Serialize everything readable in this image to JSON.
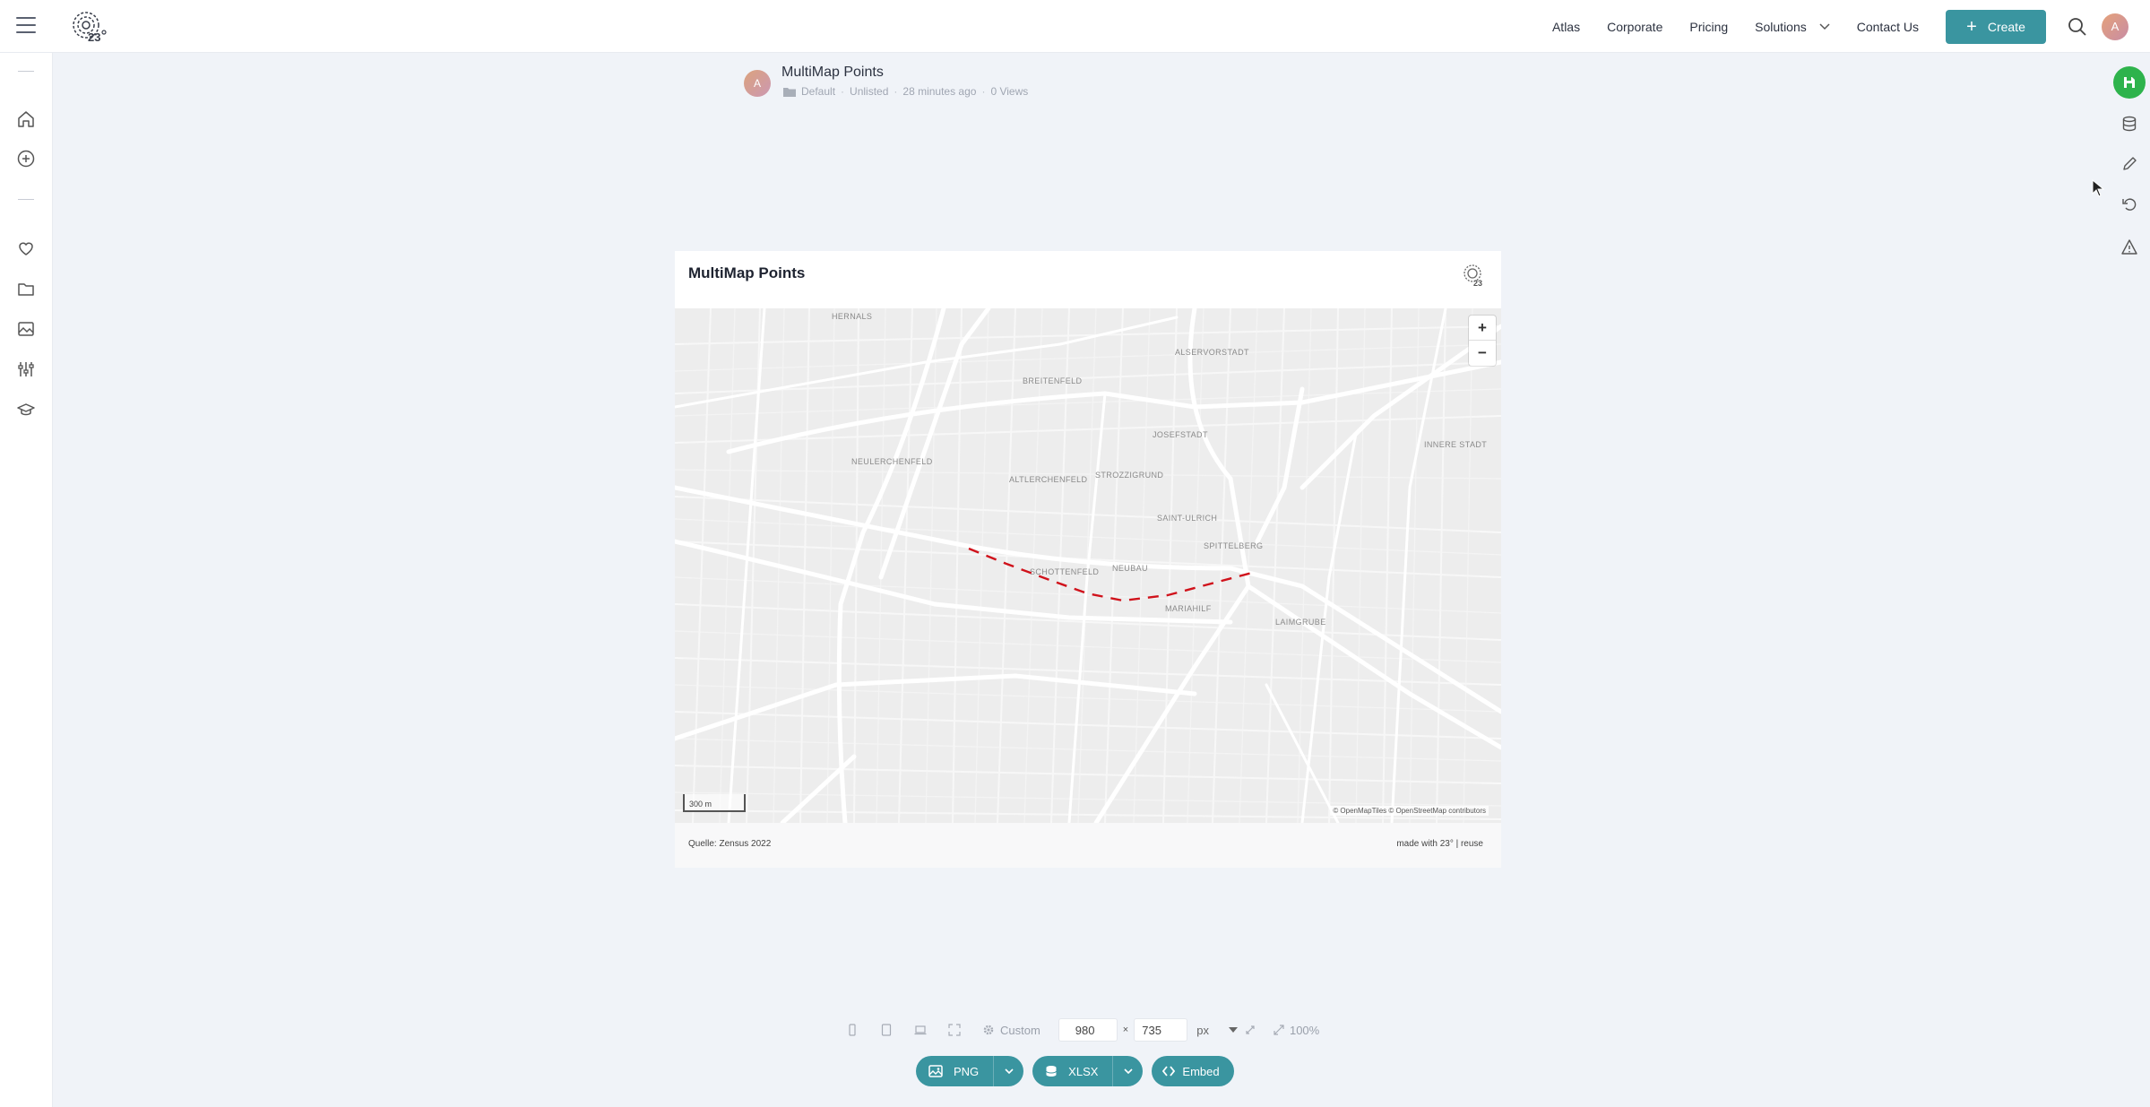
{
  "topbar": {
    "nav": [
      "Atlas",
      "Corporate",
      "Pricing",
      "Solutions",
      "Contact Us"
    ],
    "create_label": "Create",
    "avatar_initial": "A"
  },
  "sidebar": {
    "icons": [
      "home-icon",
      "plus-circle-icon",
      "heart-icon",
      "folder-icon",
      "image-icon",
      "sliders-icon",
      "graduation-cap-icon"
    ]
  },
  "right_rail": {
    "icons": [
      "save-icon",
      "database-icon",
      "pencil-icon",
      "undo-icon",
      "warning-icon"
    ],
    "save_color": "#2eb34c"
  },
  "chart_meta": {
    "avatar_initial": "A",
    "title": "MultiMap Points",
    "folder": "Default",
    "visibility": "Unlisted",
    "updated": "28 minutes ago",
    "views": "0 Views"
  },
  "card": {
    "title": "MultiMap Points",
    "source": "Quelle: Zensus 2022",
    "made_with": "made with 23° | reuse"
  },
  "map": {
    "district_labels": [
      "HERNALS",
      "ALSERVORSTADT",
      "BREITENFELD",
      "JOSEFSTADT",
      "INNERE STADT",
      "NEULERCHENFELD",
      "ALTLERCHENFELD",
      "STROZZIGRUND",
      "SAINT-ULRICH",
      "SPITTELBERG",
      "SCHOTTENFELD",
      "NEUBAU",
      "MARIAHILF",
      "LAIMGRUBE"
    ],
    "zoom_in": "+",
    "zoom_out": "−",
    "scale_label": "300 m",
    "attribution": "© OpenMapTiles © OpenStreetMap contributors",
    "route_color": "#d0121b"
  },
  "export": {
    "preset": "Custom",
    "width": "980",
    "height": "735",
    "unit": "px",
    "times": "×",
    "zoom": "100%",
    "buttons": [
      "PNG",
      "XLSX",
      "Embed"
    ],
    "accent": "#3a95a0"
  }
}
